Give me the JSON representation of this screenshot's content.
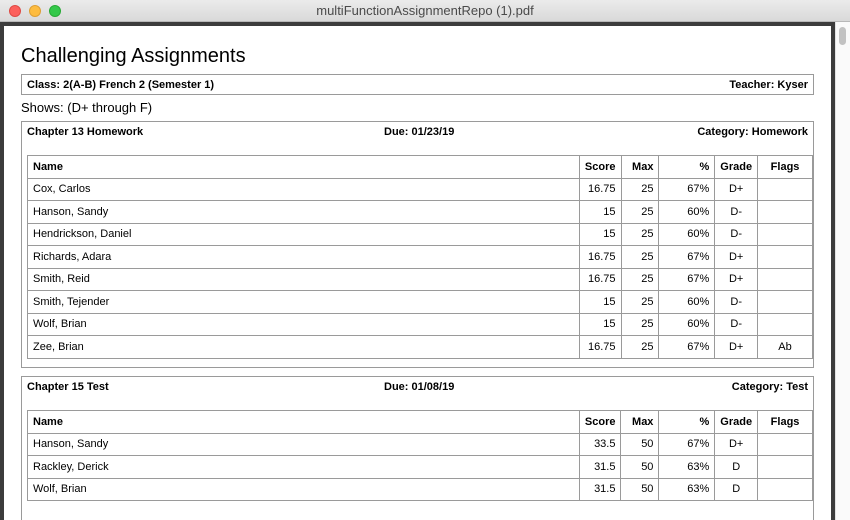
{
  "window": {
    "title": "multiFunctionAssignmentRepo (1).pdf"
  },
  "report": {
    "title": "Challenging Assignments",
    "class_label": "Class: 2(A-B) French 2 (Semester 1)",
    "teacher_label": "Teacher: Kyser",
    "shows_label": "Shows: (D+ through F)"
  },
  "columns": {
    "name": "Name",
    "score": "Score",
    "max": "Max",
    "pct": "%",
    "grade": "Grade",
    "flags": "Flags"
  },
  "assignments": [
    {
      "name": "Chapter 13 Homework",
      "due": "Due: 01/23/19",
      "category": "Category: Homework",
      "rows": [
        {
          "name": "Cox, Carlos",
          "score": "16.75",
          "max": "25",
          "pct": "67%",
          "grade": "D+",
          "flags": ""
        },
        {
          "name": "Hanson, Sandy",
          "score": "15",
          "max": "25",
          "pct": "60%",
          "grade": "D-",
          "flags": ""
        },
        {
          "name": "Hendrickson, Daniel",
          "score": "15",
          "max": "25",
          "pct": "60%",
          "grade": "D-",
          "flags": ""
        },
        {
          "name": "Richards, Adara",
          "score": "16.75",
          "max": "25",
          "pct": "67%",
          "grade": "D+",
          "flags": ""
        },
        {
          "name": "Smith, Reid",
          "score": "16.75",
          "max": "25",
          "pct": "67%",
          "grade": "D+",
          "flags": ""
        },
        {
          "name": "Smith, Tejender",
          "score": "15",
          "max": "25",
          "pct": "60%",
          "grade": "D-",
          "flags": ""
        },
        {
          "name": "Wolf, Brian",
          "score": "15",
          "max": "25",
          "pct": "60%",
          "grade": "D-",
          "flags": ""
        },
        {
          "name": "Zee, Brian",
          "score": "16.75",
          "max": "25",
          "pct": "67%",
          "grade": "D+",
          "flags": "Ab"
        }
      ]
    },
    {
      "name": "Chapter 15 Test",
      "due": "Due: 01/08/19",
      "category": "Category: Test",
      "rows": [
        {
          "name": "Hanson, Sandy",
          "score": "33.5",
          "max": "50",
          "pct": "67%",
          "grade": "D+",
          "flags": ""
        },
        {
          "name": "Rackley, Derick",
          "score": "31.5",
          "max": "50",
          "pct": "63%",
          "grade": "D",
          "flags": ""
        },
        {
          "name": "Wolf, Brian",
          "score": "31.5",
          "max": "50",
          "pct": "63%",
          "grade": "D",
          "flags": ""
        }
      ]
    }
  ]
}
